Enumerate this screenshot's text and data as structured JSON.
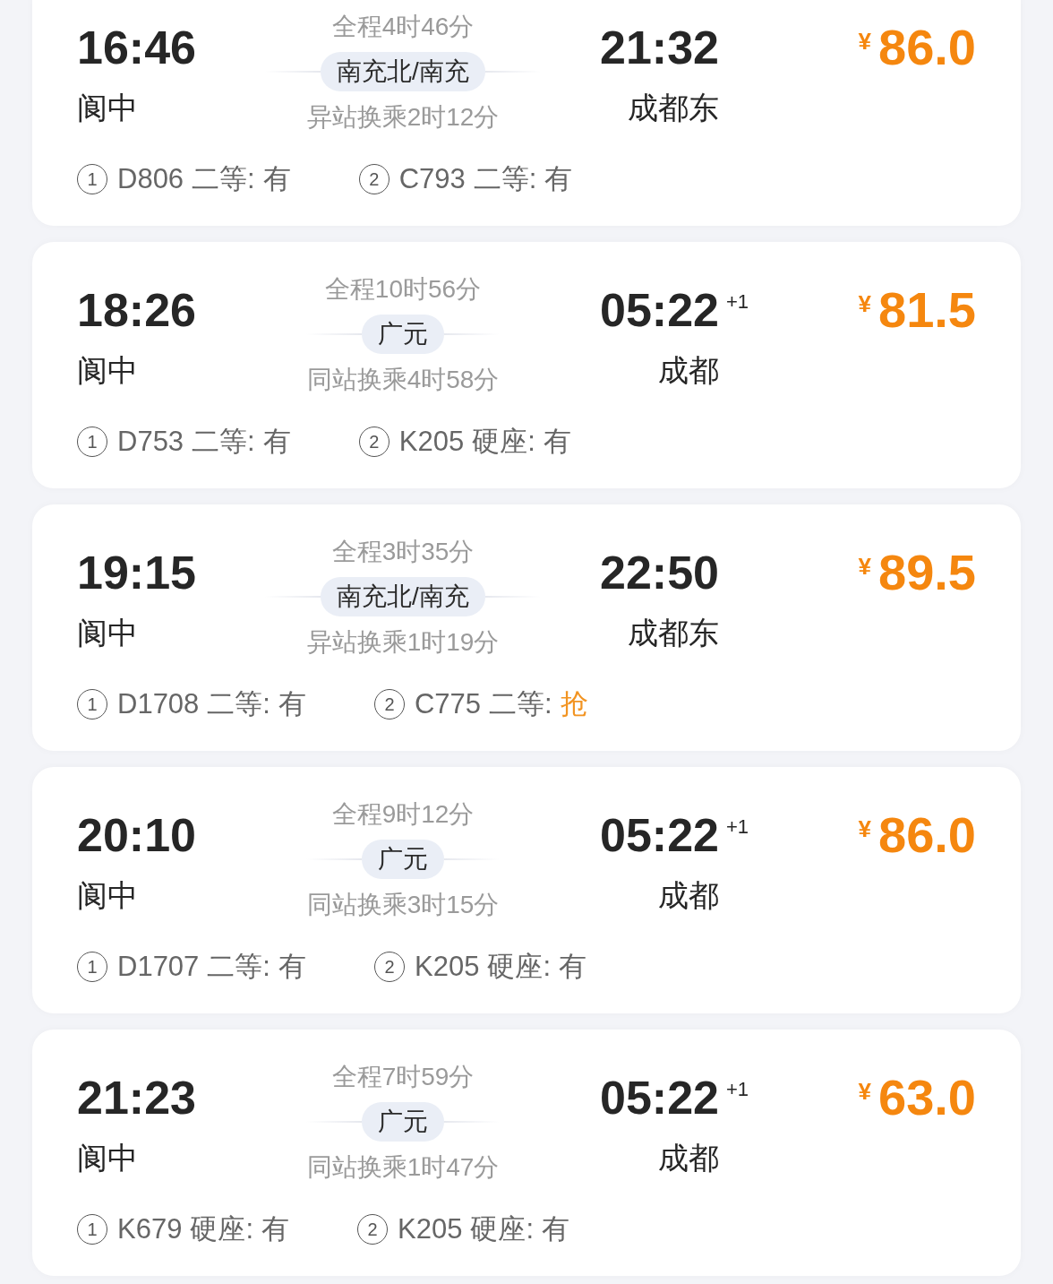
{
  "trips": [
    {
      "depart_time": "16:46",
      "depart_station": "阆中",
      "duration": "全程4时46分",
      "transfer_station": "南充北/南充",
      "transfer_info": "异站换乘2时12分",
      "arrive_time": "21:32",
      "arrive_station": "成都东",
      "currency": "¥",
      "price": "86.0",
      "legs": [
        {
          "index": "1",
          "train": "D806",
          "seat": "二等:",
          "status": "有",
          "kind": "available"
        },
        {
          "index": "2",
          "train": "C793",
          "seat": "二等:",
          "status": "有",
          "kind": "available"
        }
      ]
    },
    {
      "depart_time": "18:26",
      "depart_station": "阆中",
      "duration": "全程10时56分",
      "transfer_station": "广元",
      "transfer_info": "同站换乘4时58分",
      "arrive_time": "05:22",
      "day_offset": "+1",
      "arrive_station": "成都",
      "currency": "¥",
      "price": "81.5",
      "legs": [
        {
          "index": "1",
          "train": "D753",
          "seat": "二等:",
          "status": "有",
          "kind": "available"
        },
        {
          "index": "2",
          "train": "K205",
          "seat": "硬座:",
          "status": "有",
          "kind": "available"
        }
      ]
    },
    {
      "depart_time": "19:15",
      "depart_station": "阆中",
      "duration": "全程3时35分",
      "transfer_station": "南充北/南充",
      "transfer_info": "异站换乘1时19分",
      "arrive_time": "22:50",
      "arrive_station": "成都东",
      "currency": "¥",
      "price": "89.5",
      "legs": [
        {
          "index": "1",
          "train": "D1708",
          "seat": "二等:",
          "status": "有",
          "kind": "available"
        },
        {
          "index": "2",
          "train": "C775",
          "seat": "二等:",
          "status": "抢",
          "kind": "scarce"
        }
      ]
    },
    {
      "depart_time": "20:10",
      "depart_station": "阆中",
      "duration": "全程9时12分",
      "transfer_station": "广元",
      "transfer_info": "同站换乘3时15分",
      "arrive_time": "05:22",
      "day_offset": "+1",
      "arrive_station": "成都",
      "currency": "¥",
      "price": "86.0",
      "legs": [
        {
          "index": "1",
          "train": "D1707",
          "seat": "二等:",
          "status": "有",
          "kind": "available"
        },
        {
          "index": "2",
          "train": "K205",
          "seat": "硬座:",
          "status": "有",
          "kind": "available"
        }
      ]
    },
    {
      "depart_time": "21:23",
      "depart_station": "阆中",
      "duration": "全程7时59分",
      "transfer_station": "广元",
      "transfer_info": "同站换乘1时47分",
      "arrive_time": "05:22",
      "day_offset": "+1",
      "arrive_station": "成都",
      "currency": "¥",
      "price": "63.0",
      "legs": [
        {
          "index": "1",
          "train": "K679",
          "seat": "硬座:",
          "status": "有",
          "kind": "available"
        },
        {
          "index": "2",
          "train": "K205",
          "seat": "硬座:",
          "status": "有",
          "kind": "available"
        }
      ]
    }
  ]
}
